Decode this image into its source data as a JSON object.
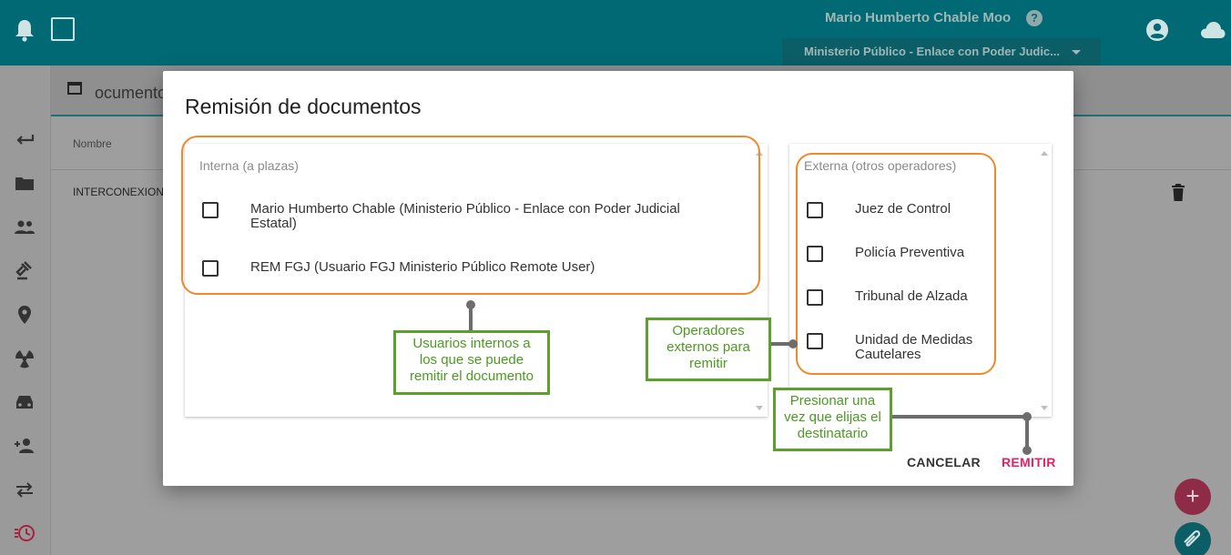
{
  "header": {
    "user_name": "Mario Humberto Chable Moo",
    "help_glyph": "?",
    "role_selected": "Ministerio Público - Enlace con Poder Judic...",
    "colors": {
      "primary": "#006973",
      "accent": "#e91e63"
    }
  },
  "subheader": {
    "title": "ocumentos"
  },
  "table": {
    "column_name": "Nombre",
    "rows": [
      {
        "name": "INTERCONEXION"
      }
    ]
  },
  "sidebar": {
    "icons": [
      "back-arrow-icon",
      "folder-icon",
      "people-icon",
      "gavel-icon",
      "location-icon",
      "hazard-icon",
      "car-icon",
      "person-add-icon",
      "swap-icon",
      "history-icon"
    ]
  },
  "fab": {
    "add_glyph": "+"
  },
  "dialog": {
    "title": "Remisión de documentos",
    "internal": {
      "heading": "Interna (a plazas)",
      "options": [
        {
          "line1": "Mario Humberto Chable (Ministerio Público - Enlace con Poder Judicial",
          "line2": "Estatal)"
        },
        {
          "line1": "REM FGJ (Usuario FGJ Ministerio Público Remote User)",
          "line2": ""
        }
      ]
    },
    "external": {
      "heading": "Externa (otros operadores)",
      "options": [
        {
          "line1": "Juez de Control",
          "line2": ""
        },
        {
          "line1": "Policía Preventiva",
          "line2": ""
        },
        {
          "line1": "Tribunal de Alzada",
          "line2": ""
        },
        {
          "line1": "Unidad de Medidas",
          "line2": "Cautelares"
        }
      ]
    },
    "cancel_label": "CANCELAR",
    "remit_label": "REMITIR"
  },
  "annotations": {
    "internal_note": [
      "Usuarios internos a",
      "los que se puede",
      "remitir el documento"
    ],
    "external_note": [
      "Operadores",
      "externos para",
      "remitir"
    ],
    "remit_note": [
      "Presionar una",
      "vez que elijas el",
      "destinatario"
    ]
  }
}
